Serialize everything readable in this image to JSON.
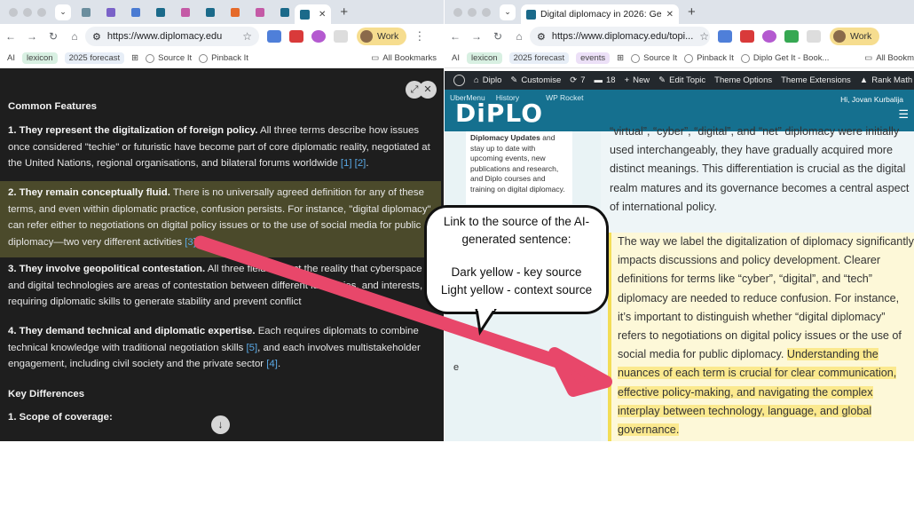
{
  "left_browser": {
    "url": "https://www.diplomacy.edu",
    "profile": "Work",
    "active_tab_title": "",
    "bookmarks": [
      {
        "label": "AI",
        "style": "plain"
      },
      {
        "label": "lexicon",
        "style": "green"
      },
      {
        "label": "2025 forecast",
        "style": "blue"
      },
      {
        "label": "Source It",
        "style": "globe"
      },
      {
        "label": "Pinback It",
        "style": "globe"
      }
    ],
    "all_bookmarks": "All Bookmarks"
  },
  "ai_answer": {
    "section_common": "Common Features",
    "features": [
      {
        "bold": "1. They represent the digitalization of foreign policy.",
        "text": " All three terms describe how issues once considered \"techie\" or futuristic have become part of core diplomatic reality, negotiated at the United Nations, regional organisations, and bilateral forums worldwide ",
        "citations": "[1] [2]",
        "end": "."
      },
      {
        "bold": "2. They remain conceptually fluid.",
        "text": " There is no universally agreed definition for any of these terms, and even within diplomatic practice, confusion persists. For instance, \"digital diplomacy\" can refer either to negotiations on digital policy issues or to the use of social media for public diplomacy—two very different activities ",
        "citations": "[3]",
        "end": "."
      },
      {
        "bold": "3. They involve geopolitical contestation.",
        "text": " All three fields reflect the reality that cyberspace and digital technologies are areas of contestation between different ideologies, and interests, requiring diplomatic skills to generate stability and prevent conflict ",
        "citations": "",
        "end": ""
      },
      {
        "bold": "4. They demand technical and diplomatic expertise.",
        "text": " Each requires diplomats to combine technical knowledge with traditional negotiation skills ",
        "citations": "[5]",
        "text2": ", and each involves multistakeholder engagement, including civil society and the private sector ",
        "citations2": "[4]",
        "end": "."
      }
    ],
    "section_differences": "Key Differences",
    "scope_heading": "1. Scope of coverage:"
  },
  "right_browser": {
    "url": "https://www.diplomacy.edu/topi...",
    "active_tab_title": "Digital diplomacy in 2026: Ge",
    "profile": "Work",
    "bookmarks": [
      {
        "label": "AI",
        "style": "plain"
      },
      {
        "label": "lexicon",
        "style": "green"
      },
      {
        "label": "2025 forecast",
        "style": "blue"
      },
      {
        "label": "events",
        "style": "purple"
      },
      {
        "label": "Source It",
        "style": "globe"
      },
      {
        "label": "Pinback It",
        "style": "globe"
      },
      {
        "label": "Diplo Get It - Book...",
        "style": "globe"
      }
    ],
    "all_bookmarks": "All Bookm",
    "wp_admin": {
      "site": "Diplo",
      "customise": "Customise",
      "updates": "7",
      "comments": "18",
      "new": "New",
      "edit": "Edit Topic",
      "theme_options": "Theme Options",
      "theme_extensions": "Theme Extensions",
      "rank_math": "Rank Math SE"
    },
    "site_header": {
      "logo": "DiPLO",
      "ubermenu": "UberMenu",
      "history": "History",
      "wp_rocket": "WP Rocket",
      "greeting": "Hi, Jovan Kurbalija"
    },
    "sidebar_card_bold": "Diplomacy Updates",
    "sidebar_card_text": " and stay up to date with upcoming events, new publications and research, and Diplo courses and training on digital diplomacy.",
    "sidebar_e": "e",
    "article_top_cut": "“virtual”, “cyber”, “digital”, and “net” diplomacy were",
    "article_top": "initially used interchangeably, they have gradually acquired more distinct meanings. This differentiation is crucial as the digital realm matures and its governance becomes a central aspect of international policy.",
    "context_source": "The way we label the digitalization of diplomacy significantly impacts discussions and policy development. Clearer definitions for terms like “cyber”, “digital”, and “tech” diplomacy are needed to reduce confusion. For instance, it’s important to distinguish whether “digital diplomacy” refers to negotiations on digital policy issues or the use of social media for public diplomacy.",
    "key_source": "Understanding the nuances of each term is crucial for clear communication, effective policy-making, and navigating the complex interplay between technology, language, and global governance."
  },
  "callout": {
    "line1": "Link to the source of the AI-generated sentence:",
    "line2": "Dark yellow - key source",
    "line3": "Light yellow - context source"
  },
  "colors": {
    "arrow": "#e8476a",
    "dark_yellow": "#fbe98e",
    "light_yellow": "#fdf8d8",
    "highlighted_paragraph": "#4b4a2b",
    "citation": "#5aa9e6"
  }
}
